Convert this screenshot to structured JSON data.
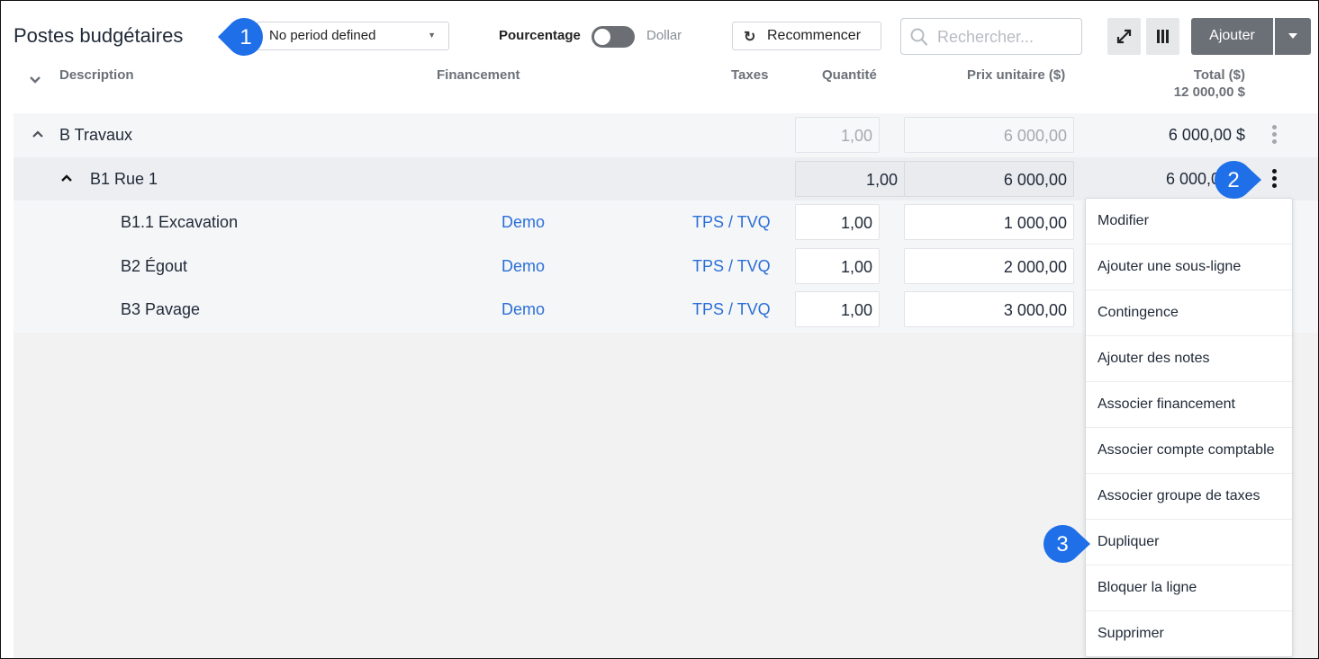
{
  "header": {
    "title": "Postes budgétaires",
    "period_select": "No period defined",
    "percent_label": "Pourcentage",
    "dollar_label": "Dollar",
    "reset_label": "Recommencer",
    "search_placeholder": "Rechercher...",
    "add_label": "Ajouter"
  },
  "columns": {
    "description": "Description",
    "financing": "Financement",
    "taxes": "Taxes",
    "quantity": "Quantité",
    "unit_price": "Prix unitaire ($)",
    "total": "Total ($)",
    "grand_total": "12 000,00 $"
  },
  "rows": [
    {
      "description": "B Travaux",
      "financing": "",
      "taxes": "",
      "quantity": "1,00",
      "unit_price": "6 000,00",
      "total": "6 000,00 $"
    },
    {
      "description": "B1 Rue 1",
      "financing": "",
      "taxes": "",
      "quantity": "1,00",
      "unit_price": "6 000,00",
      "total": "6 000,0"
    },
    {
      "description": "B1.1 Excavation",
      "financing": "Demo",
      "taxes": "TPS / TVQ",
      "quantity": "1,00",
      "unit_price": "1 000,00",
      "total": ""
    },
    {
      "description": "B2 Égout",
      "financing": "Demo",
      "taxes": "TPS / TVQ",
      "quantity": "1,00",
      "unit_price": "2 000,00",
      "total": ""
    },
    {
      "description": "B3 Pavage",
      "financing": "Demo",
      "taxes": "TPS / TVQ",
      "quantity": "1,00",
      "unit_price": "3 000,00",
      "total": ""
    }
  ],
  "menu": {
    "items": [
      "Modifier",
      "Ajouter une sous-ligne",
      "Contingence",
      "Ajouter des notes",
      "Associer financement",
      "Associer compte comptable",
      "Associer groupe de taxes",
      "Dupliquer",
      "Bloquer la ligne",
      "Supprimer"
    ]
  },
  "callouts": [
    "1",
    "2",
    "3"
  ],
  "colors": {
    "callout": "#1f6fe8",
    "link": "#2b6fd6",
    "button": "#6b7077"
  }
}
